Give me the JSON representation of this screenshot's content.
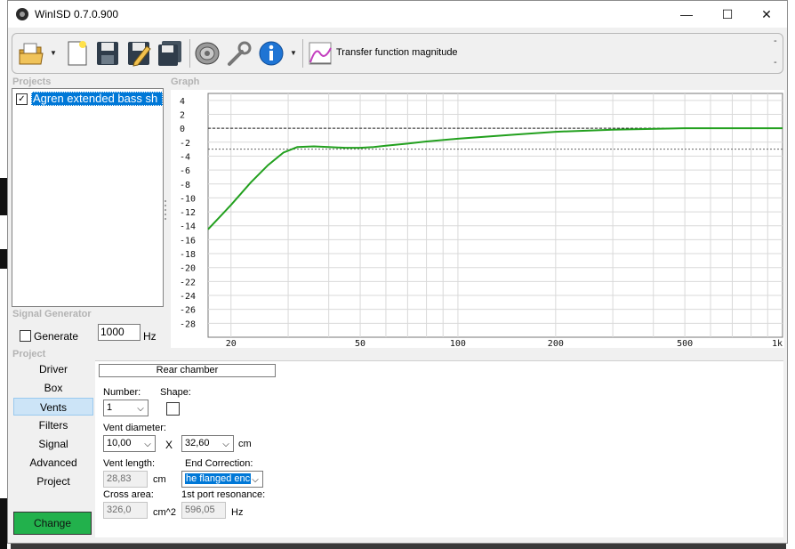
{
  "window": {
    "title": "WinISD 0.7.0.900",
    "min_glyph": "—",
    "max_glyph": "☐",
    "close_glyph": "✕"
  },
  "toolbar": {
    "transfer_label": "Transfer function magnitude",
    "dash1": "-",
    "dash2": "-"
  },
  "projects": {
    "header": "Projects",
    "item": "Agren extended bass sh",
    "checked": "✓"
  },
  "graph": {
    "header": "Graph"
  },
  "signal_generator": {
    "header": "Signal Generator",
    "generate_label": "Generate",
    "frequency": "1000",
    "unit": "Hz"
  },
  "project": {
    "header": "Project",
    "nav": [
      "Driver",
      "Box",
      "Vents",
      "Filters",
      "Signal",
      "Advanced",
      "Project"
    ],
    "selected": "Vents",
    "change_label": "Change"
  },
  "vents": {
    "chamber": "Rear chamber",
    "number_label": "Number:",
    "number_value": "1",
    "shape_label": "Shape:",
    "diameter_label": "Vent diameter:",
    "diameter_value": "10,00",
    "times": "X",
    "diameter2_value": "32,60",
    "diameter_unit": "cm",
    "length_label": "Vent length:",
    "length_value": "28,83",
    "length_unit": "cm",
    "end_corr_label": "End Correction:",
    "end_corr_value": "he flanged enc",
    "cross_label": "Cross area:",
    "cross_value": "326,0",
    "cross_unit": "cm^2",
    "res_label": "1st port resonance:",
    "res_value": "596,05",
    "res_unit": "Hz"
  },
  "chart_data": {
    "type": "line",
    "title": "",
    "xlabel": "",
    "ylabel": "",
    "x_scale": "log",
    "xlim": [
      17,
      1000
    ],
    "ylim": [
      -30,
      5
    ],
    "x_ticks": [
      20,
      50,
      100,
      200,
      500,
      1000
    ],
    "x_tick_labels": [
      "20",
      "50",
      "100",
      "200",
      "500",
      "1k"
    ],
    "y_ticks": [
      4,
      2,
      0,
      -2,
      -4,
      -6,
      -8,
      -10,
      -12,
      -14,
      -16,
      -18,
      -20,
      -22,
      -24,
      -26,
      -28
    ],
    "reference_lines": [
      0,
      -3
    ],
    "grid": true,
    "color": "#22a01e",
    "series": [
      {
        "x": [
          17,
          20,
          23,
          26,
          29,
          32,
          36,
          40,
          45,
          50,
          55,
          60,
          70,
          80,
          100,
          150,
          200,
          300,
          500,
          700,
          1000
        ],
        "y": [
          -14.5,
          -11,
          -7.8,
          -5.3,
          -3.5,
          -2.7,
          -2.6,
          -2.7,
          -2.8,
          -2.8,
          -2.7,
          -2.5,
          -2.2,
          -1.9,
          -1.5,
          -0.9,
          -0.5,
          -0.2,
          0.0,
          0.0,
          0.0
        ]
      }
    ]
  }
}
